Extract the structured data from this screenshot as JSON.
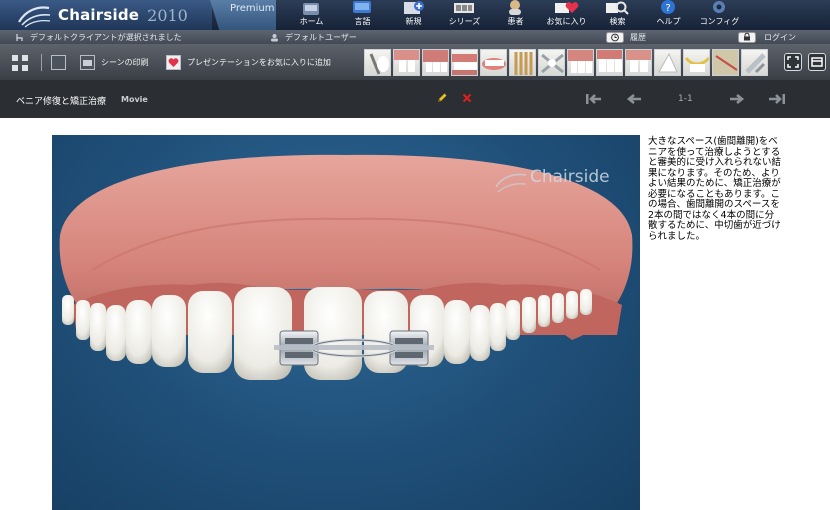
{
  "app": {
    "brand": "Chairside",
    "year": "2010",
    "edition": "Premium"
  },
  "nav": [
    {
      "label": "ホーム",
      "icon": "home-icon"
    },
    {
      "label": "言語",
      "icon": "language-icon"
    },
    {
      "label": "新規",
      "icon": "new-icon"
    },
    {
      "label": "シリーズ",
      "icon": "series-icon"
    },
    {
      "label": "患者",
      "icon": "patient-icon"
    },
    {
      "label": "お気に入り",
      "icon": "favorite-icon"
    },
    {
      "label": "検索",
      "icon": "search-icon"
    },
    {
      "label": "ヘルプ",
      "icon": "help-icon"
    },
    {
      "label": "コンフィグ",
      "icon": "config-icon"
    }
  ],
  "info": {
    "client": "デフォルトクライアントが選択されました",
    "user": "デフォルトユーザー",
    "history": "履歴",
    "login": "ログイン"
  },
  "scene_toolbar": {
    "print": "シーンの印刷",
    "add_favorite": "プレゼンテーションをお気に入りに追加"
  },
  "thumbnails_count_label": "",
  "scene": {
    "title": "ベニア修復と矯正治療",
    "type": "Movie",
    "page": "1-1"
  },
  "watermark": "Chairside",
  "description": "大きなスペース(歯間離開)をベニアを使って治療しようとすると審美的に受け入れられない結果になります。そのため、よりよい結果のために、矯正治療が必要になることもあります。この場合、歯間離開のスペースを2本の間ではなく4本の間に分散するために、中切歯が近づけられました。",
  "colors": {
    "edit_pencil": "#e8c020",
    "delete_x": "#e02020",
    "stage_blue": "#1f4f78",
    "gum": "#d5837a"
  }
}
